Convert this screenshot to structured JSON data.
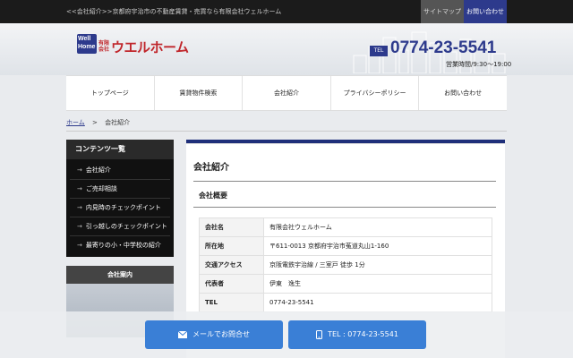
{
  "topbar": {
    "tagline": "<<会社紹介>>京都府宇治市の不動産賃貸・売買なら有限会社ウェルホーム",
    "sitemap": "サイトマップ",
    "contact": "お問い合わせ"
  },
  "header": {
    "logo": {
      "mark_top": "Well",
      "mark_bottom": "Home",
      "kind": "有限会社",
      "name": "ウエルホーム"
    },
    "tel_badge": "TEL",
    "tel": "0774-23-5541",
    "hours": "営業時間/9:30〜19:00"
  },
  "nav": [
    {
      "label": "トップページ"
    },
    {
      "label": "賃貸物件検索"
    },
    {
      "label": "会社紹介"
    },
    {
      "label": "プライバシーポリシー"
    },
    {
      "label": "お問い合わせ"
    }
  ],
  "breadcrumb": {
    "home": "ホーム",
    "sep": ">",
    "current": "会社紹介"
  },
  "sidebar": {
    "heading": "コンテンツ一覧",
    "items": [
      {
        "label": "会社紹介"
      },
      {
        "label": "ご売却相談"
      },
      {
        "label": "内見時のチェックポイント"
      },
      {
        "label": "引っ越しのチェックポイント"
      },
      {
        "label": "最寄りの小・中学校の紹介"
      }
    ],
    "box_heading": "会社案内"
  },
  "main": {
    "title": "会社紹介",
    "subtitle": "会社概要",
    "rows": [
      {
        "key": "会社名",
        "value": "有限会社ウェルホーム"
      },
      {
        "key": "所在地",
        "value": "〒611-0013 京都府宇治市菟道丸山1-160"
      },
      {
        "key": "交通アクセス",
        "value": "京阪電鉄宇治線 / 三室戸 徒歩 1分"
      },
      {
        "key": "代表者",
        "value": "伊東　逸生"
      },
      {
        "key": "TEL",
        "value": "0774-23-5541"
      }
    ]
  },
  "buttons": {
    "mail": "メールでお問合せ",
    "tel": "TEL : 0774-23-5541"
  },
  "colors": {
    "brand_blue": "#2d3a8c",
    "logo_red": "#c0262b",
    "button_blue": "#3a7fd6"
  }
}
